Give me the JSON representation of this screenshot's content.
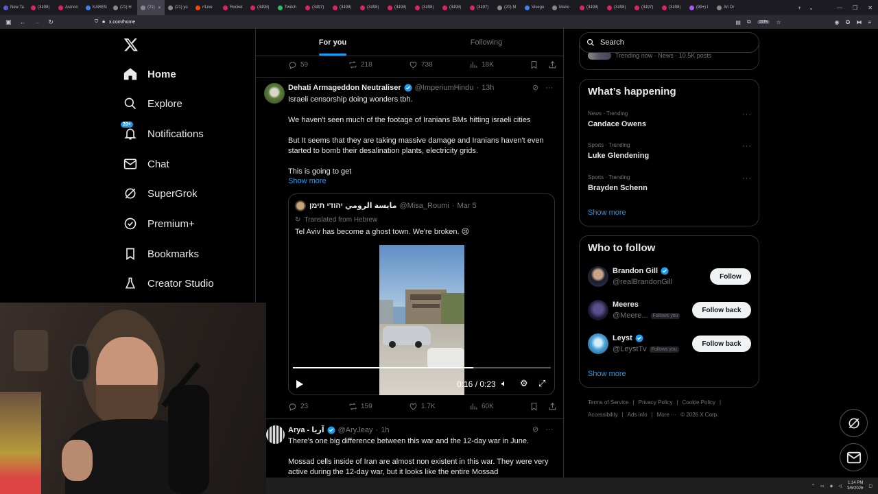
{
  "browser": {
    "tabs": [
      {
        "label": "New Ta",
        "color": "#5b5bd6"
      },
      {
        "label": "(3498)",
        "color": "#e0245e"
      },
      {
        "label": "Asmon",
        "color": "#e0245e"
      },
      {
        "label": "KAREN",
        "color": "#3b82f6"
      },
      {
        "label": "(21) H",
        "color": "#888"
      },
      {
        "label": "(21)",
        "color": "#888",
        "active": true
      },
      {
        "label": "(21) yo",
        "color": "#888"
      },
      {
        "label": "r/Live",
        "color": "#ff4500"
      },
      {
        "label": "Rocket",
        "color": "#e0245e"
      },
      {
        "label": "(3498)",
        "color": "#e0245e"
      },
      {
        "label": "Twitch",
        "color": "#22c55e"
      },
      {
        "label": "(3497)",
        "color": "#e0245e"
      },
      {
        "label": "(3498)",
        "color": "#e0245e"
      },
      {
        "label": "(3498)",
        "color": "#e0245e"
      },
      {
        "label": "(3498)",
        "color": "#e0245e"
      },
      {
        "label": "(3498)",
        "color": "#e0245e"
      },
      {
        "label": "(3498)",
        "color": "#e0245e"
      },
      {
        "label": "(3497)",
        "color": "#e0245e"
      },
      {
        "label": "(20) M",
        "color": "#888"
      },
      {
        "label": "Visego",
        "color": "#3b82f6"
      },
      {
        "label": "Mario",
        "color": "#888"
      },
      {
        "label": "(3498)",
        "color": "#e0245e"
      },
      {
        "label": "(3498)",
        "color": "#e0245e"
      },
      {
        "label": "(3497)",
        "color": "#e0245e"
      },
      {
        "label": "(3498)",
        "color": "#e0245e"
      },
      {
        "label": "(99+) I",
        "color": "#a855f7"
      },
      {
        "label": "Ari Dr",
        "color": "#888"
      }
    ],
    "url": "x.com/home",
    "zoom": "150%"
  },
  "nav": {
    "home": "Home",
    "explore": "Explore",
    "notifications": "Notifications",
    "notifications_badge": "20+",
    "chat": "Chat",
    "supergrok": "SuperGrok",
    "premium": "Premium+",
    "bookmarks": "Bookmarks",
    "creator_studio": "Creator Studio"
  },
  "feed": {
    "tab_for_you": "For you",
    "tab_following": "Following",
    "prev_tweet_stats": {
      "replies": "59",
      "reposts": "218",
      "likes": "738",
      "views": "18K"
    },
    "tweet1": {
      "name": "Dehati Armageddon Neutraliser",
      "handle": "@ImperiumHindu",
      "time": "13h",
      "p1": "Israeli censorship doing wonders tbh.",
      "p2": "We haven't seen much of the footage of Iranians BMs hitting israeli cities",
      "p3": "But It seems that they are taking massive damage and Iranians haven't even started to bomb their desalination plants, electricity grids.",
      "p4": "This is going to get",
      "show_more": "Show more",
      "stats": {
        "replies": "23",
        "reposts": "159",
        "likes": "1.7K",
        "views": "60K"
      }
    },
    "quote": {
      "name": "مايسة الرومي יהודי תימן",
      "handle": "@Misa_Roumi",
      "time": "Mar 5",
      "translated": "Translated from Hebrew",
      "text": "Tel Aviv has become a ghost town. We're broken. 😢",
      "video_time": "0:16 / 0:23",
      "progress": 0.7
    },
    "tweet2": {
      "name": "Arya - آریا",
      "handle": "@AryJeay",
      "time": "1h",
      "p1": "There's one big difference between this war and the 12-day war in June.",
      "p2": "Mossad cells inside of Iran are almost non existent in this war. They were very active during the 12-day war, but it looks like the entire Mossad"
    }
  },
  "sidebar": {
    "search_placeholder": "Search",
    "trending_now": "Trending now · News · 10.5K posts",
    "whats_happening": "What’s happening",
    "trends": [
      {
        "category": "News · Trending",
        "name": "Candace Owens"
      },
      {
        "category": "Sports · Trending",
        "name": "Luke Glendening"
      },
      {
        "category": "Sports · Trending",
        "name": "Brayden Schenn"
      }
    ],
    "show_more": "Show more",
    "who_to_follow": "Who to follow",
    "follows": [
      {
        "name": "Brandon Gill",
        "handle": "@realBrandonGill",
        "verified": true,
        "follows_you": "",
        "button": "Follow"
      },
      {
        "name": "Meeres",
        "handle": "@Meere...",
        "verified": false,
        "follows_you": "Follows you",
        "button": "Follow back"
      },
      {
        "name": "Leyst",
        "handle": "@LeystTv",
        "verified": true,
        "follows_you": "Follows you",
        "button": "Follow back"
      }
    ],
    "show_more_2": "Show more",
    "footer": [
      "Terms of Service",
      "|",
      "Privacy Policy",
      "|",
      "Cookie Policy",
      "|"
    ],
    "footer2": [
      "Accessibility",
      "|",
      "Ads info",
      "|",
      "More ···",
      "© 2026 X Corp."
    ]
  },
  "taskbar": {
    "time": "1:14 PM",
    "date": "3/6/2026"
  }
}
